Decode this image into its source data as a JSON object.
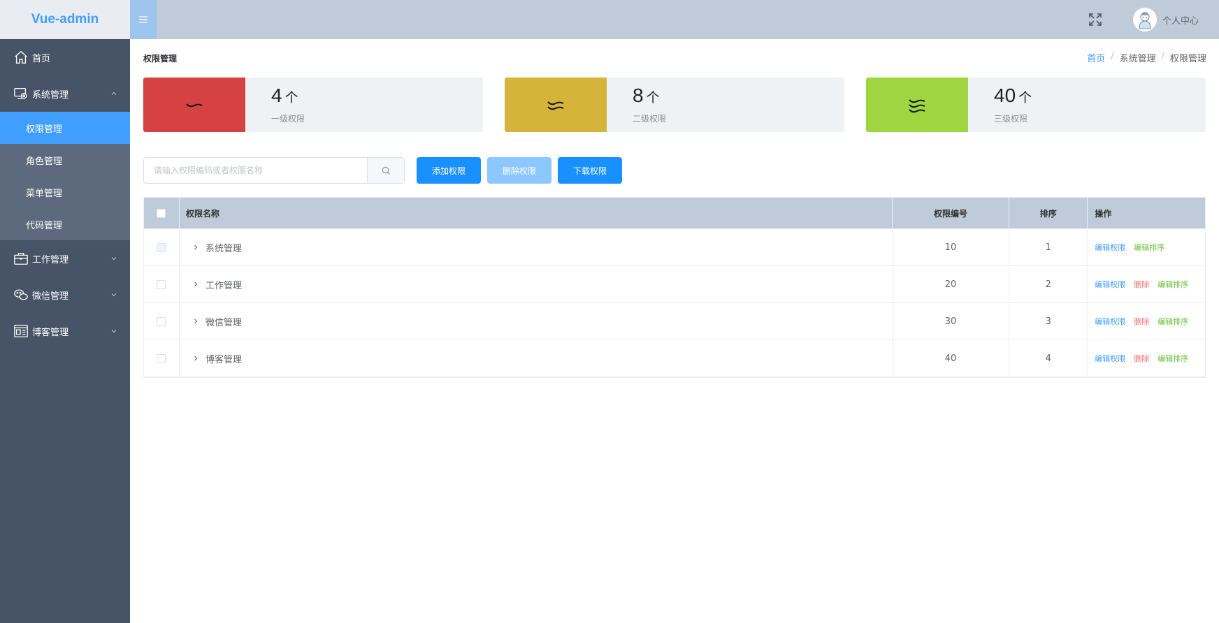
{
  "app": {
    "logo_text": "Vue-admin"
  },
  "sidebar": {
    "items": [
      {
        "label": "首页",
        "icon": "home-icon"
      },
      {
        "label": "系统管理",
        "icon": "system-settings-icon",
        "expanded": true,
        "children": [
          {
            "label": "权限管理",
            "active": true
          },
          {
            "label": "角色管理"
          },
          {
            "label": "菜单管理"
          },
          {
            "label": "代码管理"
          }
        ]
      },
      {
        "label": "工作管理",
        "icon": "briefcase-icon",
        "expanded": false
      },
      {
        "label": "微信管理",
        "icon": "wechat-icon",
        "expanded": false
      },
      {
        "label": "博客管理",
        "icon": "blog-icon",
        "expanded": false
      }
    ]
  },
  "header": {
    "toggle_icon": "hamburger-icon",
    "fullscreen_icon": "fullscreen-icon",
    "user_label": "个人中心"
  },
  "page": {
    "title": "权限管理",
    "breadcrumb": [
      "首页",
      "系统管理",
      "权限管理"
    ]
  },
  "stats": [
    {
      "value": "4",
      "unit": "个",
      "label": "一级权限",
      "color": "#d64141"
    },
    {
      "value": "8",
      "unit": "个",
      "label": "二级权限",
      "color": "#d4b43a"
    },
    {
      "value": "40",
      "unit": "个",
      "label": "三级权限",
      "color": "#9fd541"
    }
  ],
  "toolbar": {
    "search_placeholder": "请输入权限编码或者权限名称",
    "search_value": "",
    "add_label": "添加权限",
    "delete_label": "删除权限",
    "download_label": "下载权限"
  },
  "table": {
    "headers": {
      "name": "权限名称",
      "code": "权限编号",
      "sort": "排序",
      "ops": "操作"
    },
    "rows": [
      {
        "name": "系统管理",
        "code": "10",
        "sort": "1",
        "ops": [
          "编辑权限",
          "编辑排序"
        ]
      },
      {
        "name": "工作管理",
        "code": "20",
        "sort": "2",
        "ops": [
          "编辑权限",
          "删除",
          "编辑排序"
        ]
      },
      {
        "name": "微信管理",
        "code": "30",
        "sort": "3",
        "ops": [
          "编辑权限",
          "删除",
          "编辑排序"
        ]
      },
      {
        "name": "博客管理",
        "code": "40",
        "sort": "4",
        "ops": [
          "编辑权限",
          "删除",
          "编辑排序"
        ]
      }
    ]
  }
}
